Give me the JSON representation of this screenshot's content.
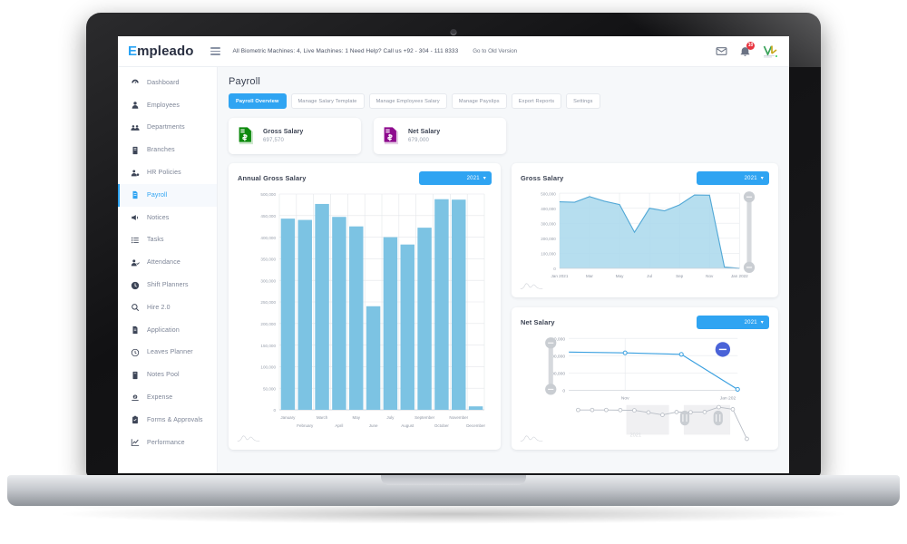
{
  "brand": {
    "name_first": "E",
    "name_rest": "mpleado"
  },
  "topbar": {
    "info": "All Biometric Machines: 4,  Live Machines: 1   Need Help? Call us +92 - 304 - 111 8333",
    "old_version": "Go to Old Version",
    "notification_count": "10",
    "icons": {
      "menu": "hamburger-icon",
      "mail": "mail-icon",
      "bell": "bell-icon",
      "avatar": "avatar-icon"
    }
  },
  "sidebar": {
    "items": [
      {
        "label": "Dashboard",
        "icon": "speedometer-icon",
        "active": false
      },
      {
        "label": "Employees",
        "icon": "user-icon",
        "active": false
      },
      {
        "label": "Departments",
        "icon": "users-group-icon",
        "active": false
      },
      {
        "label": "Branches",
        "icon": "building-icon",
        "active": false
      },
      {
        "label": "HR Policies",
        "icon": "user-settings-icon",
        "active": false
      },
      {
        "label": "Payroll",
        "icon": "payroll-file-icon",
        "active": true
      },
      {
        "label": "Notices",
        "icon": "megaphone-icon",
        "active": false
      },
      {
        "label": "Tasks",
        "icon": "list-icon",
        "active": false
      },
      {
        "label": "Attendance",
        "icon": "user-check-icon",
        "active": false
      },
      {
        "label": "Shift Planners",
        "icon": "clock-filled-icon",
        "active": false
      },
      {
        "label": "Hire 2.0",
        "icon": "search-icon",
        "active": false
      },
      {
        "label": "Application",
        "icon": "document-icon",
        "active": false
      },
      {
        "label": "Leaves Planner",
        "icon": "clock-icon",
        "active": false
      },
      {
        "label": "Notes Pool",
        "icon": "note-icon",
        "active": false
      },
      {
        "label": "Expense",
        "icon": "money-icon",
        "active": false
      },
      {
        "label": "Forms & Approvals",
        "icon": "clipboard-icon",
        "active": false
      },
      {
        "label": "Performance",
        "icon": "chart-up-icon",
        "active": false
      }
    ]
  },
  "page": {
    "title": "Payroll",
    "tabs": [
      {
        "label": "Payroll Overview",
        "active": true
      },
      {
        "label": "Manage Salary Template",
        "active": false
      },
      {
        "label": "Manage Employees Salary",
        "active": false
      },
      {
        "label": "Manage Payslips",
        "active": false
      },
      {
        "label": "Export Reports",
        "active": false
      },
      {
        "label": "Settings",
        "active": false
      }
    ],
    "stats": [
      {
        "label": "Gross Salary",
        "value": "697,570",
        "icon": "salary-file-dollar-icon",
        "color": "#128a12"
      },
      {
        "label": "Net Salary",
        "value": "679,000",
        "icon": "salary-file-dollar-icon",
        "color": "#8e0b8e"
      }
    ]
  },
  "cards": {
    "annual_gross": {
      "title": "Annual Gross Salary",
      "year": "2021"
    },
    "gross": {
      "title": "Gross Salary",
      "year": "2021"
    },
    "net": {
      "title": "Net Salary",
      "year": "2021"
    }
  },
  "colors": {
    "accent": "#2fa4f2",
    "bar_fill": "#7cc3e3",
    "area_fill": "#a9d8ec",
    "area_stroke": "#52a8d6",
    "line_stroke": "#3aa0e0",
    "gross_green": "#128a12",
    "net_purple": "#8e0b8e",
    "badge_red": "#e8343f"
  },
  "chart_data": [
    {
      "id": "annual-gross-salary",
      "type": "bar",
      "title": "Annual Gross Salary",
      "xlabel": "",
      "ylabel": "",
      "ylim": [
        0,
        500000
      ],
      "yticks": [
        0,
        50000,
        100000,
        150000,
        200000,
        250000,
        300000,
        350000,
        400000,
        450000,
        500000
      ],
      "ytick_labels": [
        "0",
        "50,000",
        "100,000",
        "150,000",
        "200,000",
        "250,000",
        "300,000",
        "350,000",
        "400,000",
        "450,000",
        "500,000"
      ],
      "grid": true,
      "legend": "none",
      "categories": [
        "January",
        "February",
        "March",
        "April",
        "May",
        "June",
        "July",
        "August",
        "September",
        "October",
        "November",
        "December"
      ],
      "values": [
        443000,
        440000,
        477000,
        447000,
        425000,
        240000,
        400000,
        383000,
        422000,
        488000,
        487000,
        8000
      ]
    },
    {
      "id": "gross-salary",
      "type": "area",
      "title": "Gross Salary",
      "xlabel": "",
      "ylabel": "",
      "ylim": [
        0,
        500000
      ],
      "yticks": [
        0,
        100000,
        200000,
        300000,
        400000,
        500000
      ],
      "ytick_labels": [
        "0",
        "100,000",
        "200,000",
        "300,000",
        "400,000",
        "500,000"
      ],
      "grid": true,
      "legend": "none",
      "x": [
        "Jan 2021",
        "Feb",
        "Mar",
        "Apr",
        "May",
        "Jun",
        "Jul",
        "Aug",
        "Sep",
        "Oct",
        "Nov",
        "Dec",
        "Jan 2022"
      ],
      "xtick_labels": [
        "Jan 2021",
        "Mar",
        "May",
        "Jul",
        "Sep",
        "Nov",
        "Jan 2022"
      ],
      "values": [
        443000,
        440000,
        477000,
        447000,
        425000,
        240000,
        400000,
        383000,
        422000,
        488000,
        487000,
        8000,
        0
      ]
    },
    {
      "id": "net-salary",
      "type": "line",
      "title": "Net Salary",
      "xlabel": "",
      "ylabel": "",
      "ylim": [
        0,
        600000
      ],
      "yticks": [
        0,
        200000,
        400000,
        600000
      ],
      "ytick_labels": [
        "0",
        "200,000",
        "400,000",
        "600,000"
      ],
      "grid": true,
      "legend": "none",
      "x": [
        "Oct",
        "Nov",
        "Dec",
        "Jan 202"
      ],
      "xtick_labels": [
        "Nov",
        "Jan 202"
      ],
      "values": [
        440000,
        432000,
        415000,
        10000
      ],
      "navigator": {
        "label": "2021",
        "values": [
          430,
          430,
          430,
          428,
          425,
          395,
          360,
          400,
          398,
          402,
          470,
          440,
          20
        ]
      }
    }
  ]
}
